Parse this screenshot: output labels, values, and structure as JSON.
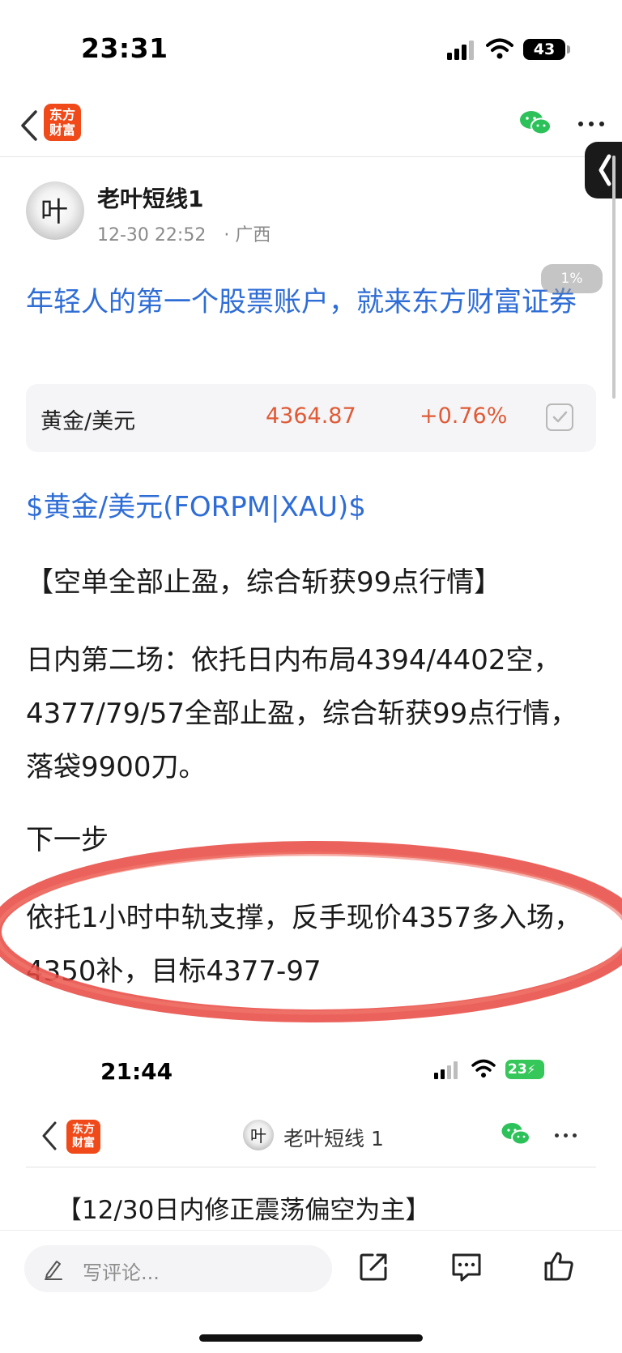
{
  "status_bar": {
    "time": "23:31",
    "battery": "43"
  },
  "nav": {
    "brand_logo": "东方财富",
    "icons": [
      "back-chevron-icon",
      "wechat-icon",
      "more-icon"
    ]
  },
  "side_tab_icon": "chevron-left-icon",
  "progress_pill": "1%",
  "post": {
    "author": "老叶短线1",
    "avatar_text": "叶",
    "date": "12-30 22:52",
    "location": "· 广西",
    "title": "年轻人的第一个股票账户，就来东方财富证券",
    "quote": {
      "name": "黄金/美元",
      "price": "4364.87",
      "change": "+0.76%"
    },
    "stock_tag": "$黄金/美元(FORPM|XAU)$",
    "paragraphs": [
      "【空单全部止盈，综合斩获99点行情】",
      "日内第二场：依托日内布局4394/4402空，4377/79/57全部止盈，综合斩获99点行情，落袋9900刀。",
      "下一步",
      "依托1小时中轨支撑，反手现价4357多入场，4350补，目标4377-97"
    ]
  },
  "embedded_screenshot": {
    "time": "21:44",
    "battery": "23",
    "brand_logo": "东方财富",
    "author": "老叶短线 1",
    "avatar_text": "叶",
    "headline": "【12/30日内修正震荡偏空为主】"
  },
  "bottom_bar": {
    "comment_placeholder": "写评论...",
    "actions": [
      "share-icon",
      "comment-icon",
      "like-icon"
    ]
  },
  "colors": {
    "link_blue": "#2f6dd6",
    "price_red": "#e05a36",
    "brand_orange": "#f04a1a",
    "annotation_red": "#e8473f"
  }
}
